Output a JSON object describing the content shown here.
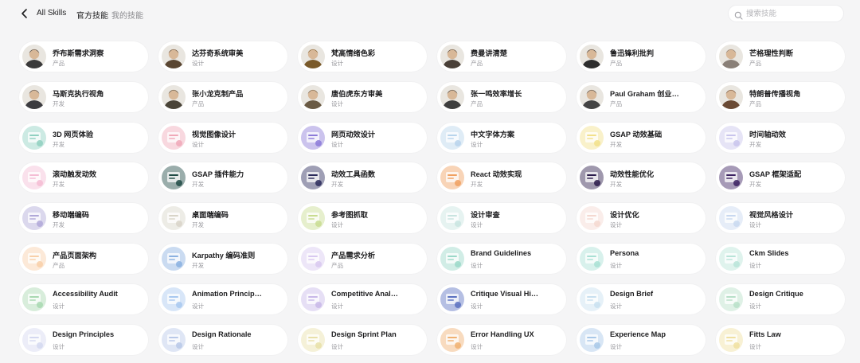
{
  "header": {
    "back_icon": "chevron-left-icon",
    "breadcrumb": "All Skills",
    "tabs": [
      {
        "label": "官方技能",
        "active": true
      },
      {
        "label": "我的技能",
        "active": false
      }
    ],
    "search": {
      "placeholder": "搜索技能",
      "value": "",
      "icon": "search-icon"
    }
  },
  "skills": [
    {
      "name": "乔布斯需求洞察",
      "category": "产品",
      "thumb": "portrait",
      "color": "#3a3a3a"
    },
    {
      "name": "达芬奇系统审美",
      "category": "设计",
      "thumb": "portrait",
      "color": "#5a4632"
    },
    {
      "name": "梵高情绪色彩",
      "category": "设计",
      "thumb": "portrait",
      "color": "#7a5a2a"
    },
    {
      "name": "费曼讲清楚",
      "category": "产品",
      "thumb": "portrait",
      "color": "#4a4038"
    },
    {
      "name": "鲁迅锋利批判",
      "category": "产品",
      "thumb": "portrait",
      "color": "#2e2e2e"
    },
    {
      "name": "芒格理性判断",
      "category": "产品",
      "thumb": "portrait",
      "color": "#8a8078"
    },
    {
      "name": "马斯克执行视角",
      "category": "开发",
      "thumb": "portrait",
      "color": "#3c3c40"
    },
    {
      "name": "张小龙克制产品",
      "category": "产品",
      "thumb": "portrait",
      "color": "#4a4438"
    },
    {
      "name": "唐伯虎东方审美",
      "category": "设计",
      "thumb": "portrait",
      "color": "#6a5a44"
    },
    {
      "name": "张一鸣效率增长",
      "category": "产品",
      "thumb": "portrait",
      "color": "#3e3e3e"
    },
    {
      "name": "Paul Graham 创业…",
      "category": "产品",
      "thumb": "portrait",
      "color": "#444444"
    },
    {
      "name": "特朗普传播视角",
      "category": "产品",
      "thumb": "portrait",
      "color": "#6a4a34"
    },
    {
      "name": "3D 网页体验",
      "category": "开发",
      "thumb": "art",
      "color": "#8fd0c0"
    },
    {
      "name": "视觉图像设计",
      "category": "设计",
      "thumb": "art",
      "color": "#f0a8b8"
    },
    {
      "name": "网页动效设计",
      "category": "设计",
      "thumb": "art",
      "color": "#8c7ad8"
    },
    {
      "name": "中文字体方案",
      "category": "设计",
      "thumb": "art",
      "color": "#b8d4ec"
    },
    {
      "name": "GSAP 动效基础",
      "category": "开发",
      "thumb": "art",
      "color": "#f2e08a"
    },
    {
      "name": "时间轴动效",
      "category": "开发",
      "thumb": "art",
      "color": "#c8c4ec"
    },
    {
      "name": "滚动触发动效",
      "category": "开发",
      "thumb": "art",
      "color": "#f4bcd4"
    },
    {
      "name": "GSAP 插件能力",
      "category": "开发",
      "thumb": "art",
      "color": "#1e4a44"
    },
    {
      "name": "动效工具函数",
      "category": "开发",
      "thumb": "art",
      "color": "#2a2a5a"
    },
    {
      "name": "React 动效实现",
      "category": "开发",
      "thumb": "art",
      "color": "#f0a060"
    },
    {
      "name": "动效性能优化",
      "category": "开发",
      "thumb": "art",
      "color": "#2a1a4a"
    },
    {
      "name": "GSAP 框架适配",
      "category": "开发",
      "thumb": "art",
      "color": "#3a2060"
    },
    {
      "name": "移动端编码",
      "category": "开发",
      "thumb": "art",
      "color": "#b0a8d8"
    },
    {
      "name": "桌面端编码",
      "category": "开发",
      "thumb": "art",
      "color": "#d8d4c8"
    },
    {
      "name": "参考图抓取",
      "category": "设计",
      "thumb": "art",
      "color": "#c8dc90"
    },
    {
      "name": "设计审查",
      "category": "设计",
      "thumb": "art",
      "color": "#c8e4e0"
    },
    {
      "name": "设计优化",
      "category": "设计",
      "thumb": "art",
      "color": "#f4d8d0"
    },
    {
      "name": "视觉风格设计",
      "category": "设计",
      "thumb": "art",
      "color": "#c8d8f0"
    },
    {
      "name": "产品页面架构",
      "category": "产品",
      "thumb": "art",
      "color": "#f8cfa8"
    },
    {
      "name": "Karpathy 编码准则",
      "category": "开发",
      "thumb": "art",
      "color": "#8ab0e0"
    },
    {
      "name": "产品需求分析",
      "category": "产品",
      "thumb": "art",
      "color": "#d8c8f0"
    },
    {
      "name": "Brand Guidelines",
      "category": "设计",
      "thumb": "art",
      "color": "#9ad8c8"
    },
    {
      "name": "Persona",
      "category": "设计",
      "thumb": "art",
      "color": "#a8e0d4"
    },
    {
      "name": "Ckm Slides",
      "category": "设计",
      "thumb": "art",
      "color": "#b8e4d8"
    },
    {
      "name": "Accessibility Audit",
      "category": "设计",
      "thumb": "art",
      "color": "#a8d8b0"
    },
    {
      "name": "Animation Princip…",
      "category": "设计",
      "thumb": "art",
      "color": "#a8c8f0"
    },
    {
      "name": "Competitive Anal…",
      "category": "设计",
      "thumb": "art",
      "color": "#c8b8e8"
    },
    {
      "name": "Critique Visual Hi…",
      "category": "设计",
      "thumb": "art",
      "color": "#5a70c0"
    },
    {
      "name": "Design Brief",
      "category": "设计",
      "thumb": "art",
      "color": "#c8e0f0"
    },
    {
      "name": "Design Critique",
      "category": "设计",
      "thumb": "art",
      "color": "#b8e0c8"
    },
    {
      "name": "Design Principles",
      "category": "设计",
      "thumb": "art",
      "color": "#d4d8f0"
    },
    {
      "name": "Design Rationale",
      "category": "设计",
      "thumb": "art",
      "color": "#b8c8e8"
    },
    {
      "name": "Design Sprint Plan",
      "category": "设计",
      "thumb": "art",
      "color": "#e8e0a8"
    },
    {
      "name": "Error Handling UX",
      "category": "设计",
      "thumb": "art",
      "color": "#f0b070"
    },
    {
      "name": "Experience Map",
      "category": "设计",
      "thumb": "art",
      "color": "#a8c8e8"
    },
    {
      "name": "Fitts Law",
      "category": "设计",
      "thumb": "art",
      "color": "#f0e0a0"
    }
  ]
}
